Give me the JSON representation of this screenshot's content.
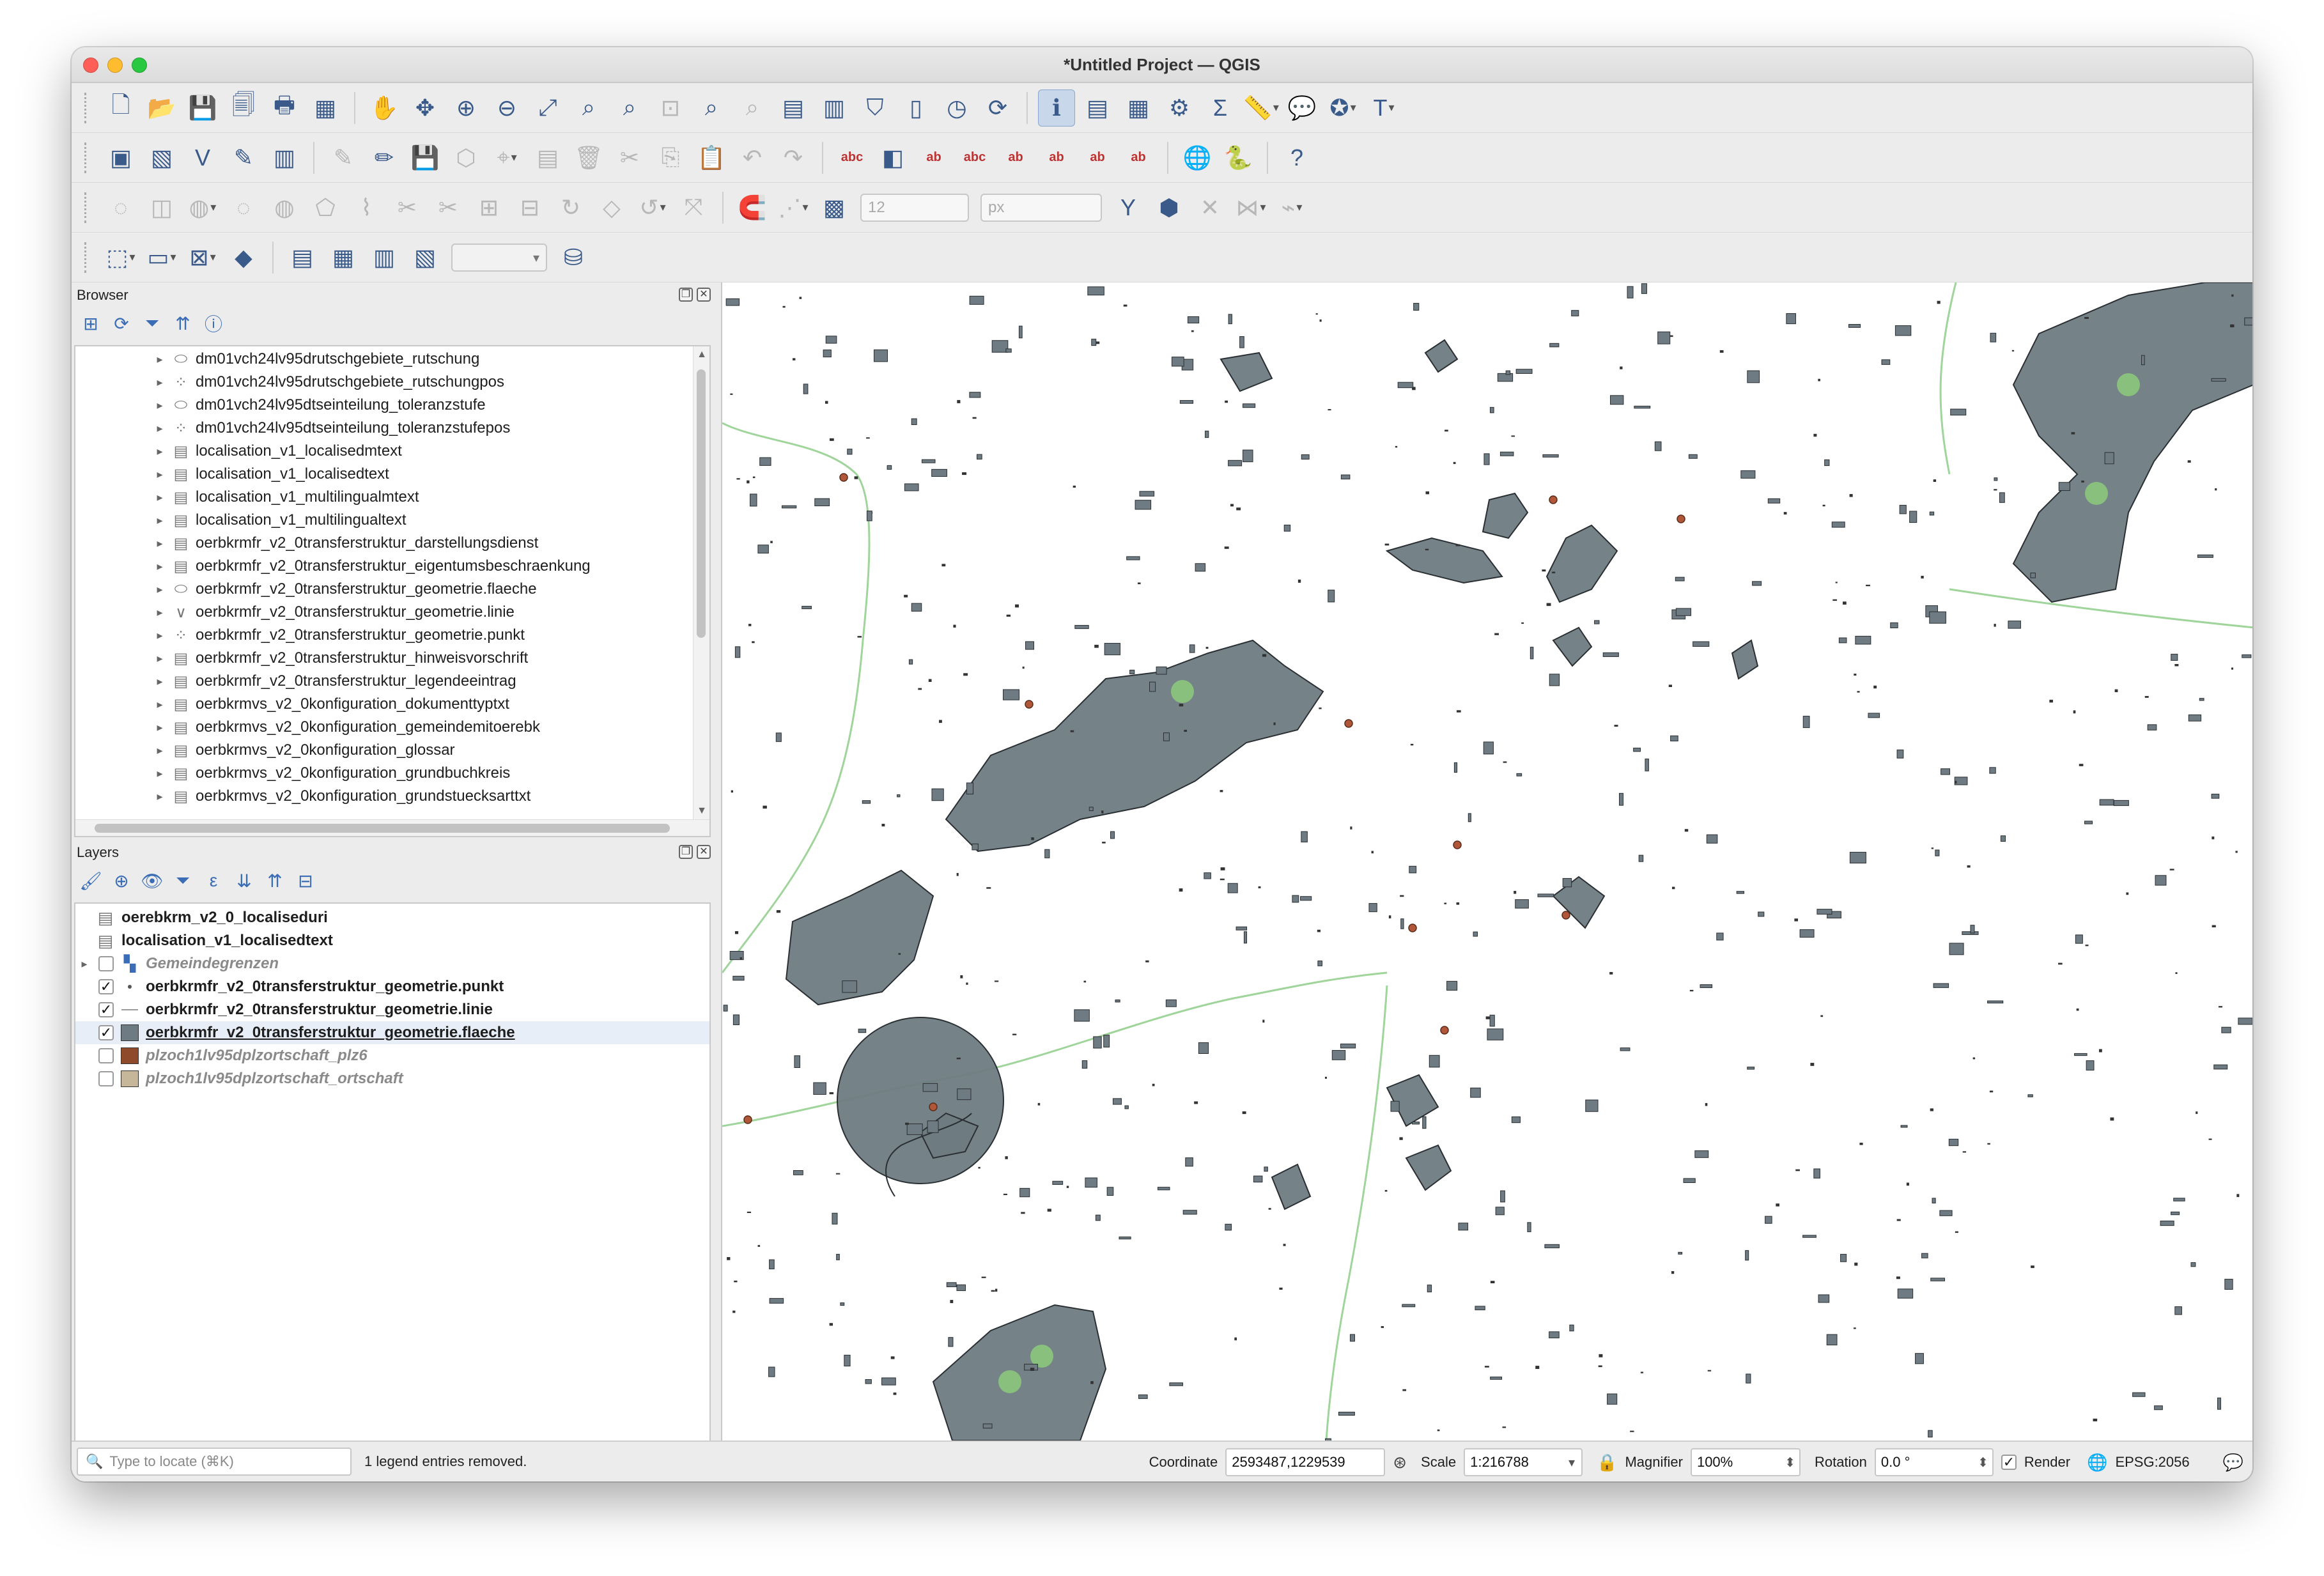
{
  "window": {
    "title": "*Untitled Project — QGIS"
  },
  "toolbars": {
    "row1": [
      "new-project-icon",
      "open-project-icon",
      "save-project-icon",
      "save-as-icon",
      "print-layout-icon",
      "layout-manager-icon",
      "|",
      "pan-icon",
      "pan-to-selection-icon",
      "zoom-in-icon",
      "zoom-out-icon",
      "zoom-full-icon",
      "zoom-to-selection-icon",
      "zoom-to-layer-icon",
      "zoom-native-icon",
      "zoom-last-icon",
      "zoom-next-icon",
      "new-bookmark-icon",
      "show-bookmarks-icon",
      "temporal-icon",
      "tile-scale-icon",
      "time-controller-icon",
      "refresh-icon",
      "|",
      "identify-icon",
      "attribute-table-icon",
      "field-calculator-icon",
      "processing-toolbox-icon",
      "statistics-icon",
      "measure-icon",
      "map-tips-icon",
      "annotation-icon",
      "text-annotation-icon"
    ],
    "row2": [
      "data-source-manager-icon",
      "new-geopackage-icon",
      "new-shapefile-icon",
      "new-temporary-layer-icon",
      "new-virtual-layer-icon",
      "|",
      "digitize-icon",
      "edit-pencil-icon",
      "save-edits-icon",
      "add-feature-icon",
      "vertex-tool-icon",
      "modify-attributes-icon",
      "delete-selected-icon",
      "cut-icon",
      "copy-icon",
      "paste-icon",
      "undo-icon",
      "redo-icon",
      "|",
      "label-tool-icon",
      "diagram-tool-icon",
      "label-pin-icon",
      "label-highlight-icon",
      "label-show-hide-icon",
      "label-move-icon",
      "label-rotate-icon",
      "label-change-icon",
      "|",
      "plugin-globe-icon",
      "python-console-icon",
      "|",
      "help-icon"
    ],
    "row3": [
      "add-ring-icon",
      "add-part-icon",
      "fill-ring-icon",
      "delete-ring-icon",
      "delete-part-icon",
      "reshape-icon",
      "offset-curve-icon",
      "split-features-icon",
      "split-parts-icon",
      "merge-features-icon",
      "merge-attributes-icon",
      "rotate-point-symbols-icon",
      "simplify-icon",
      "rotate-feature-icon",
      "scale-feature-icon",
      "|",
      "snapping-magnet-icon",
      "snapping-type-icon",
      "snapping-grid-icon"
    ],
    "row3_tolerance": "12",
    "row3_unit": "px",
    "row3_after": [
      "tracing-icon",
      "self-snapping-icon",
      "intersection-icon",
      "topology-icon",
      "avoid-overlap-icon"
    ],
    "row4": [
      "select-features-icon",
      "deselect-icon",
      "select-by-expression-icon",
      "select-location-icon",
      "|",
      "db-manager-icon",
      "open-table-icon",
      "create-view-icon",
      "query-builder-icon"
    ],
    "row4_after": [
      "db-stack-icon"
    ]
  },
  "browser": {
    "title": "Browser",
    "tools": [
      "add-selected-icon",
      "refresh-browser-icon",
      "filter-browser-icon",
      "collapse-all-icon",
      "properties-icon"
    ],
    "items": [
      {
        "icon": "polygon",
        "label": "dm01vch24lv95drutschgebiete_rutschung"
      },
      {
        "icon": "point",
        "label": "dm01vch24lv95drutschgebiete_rutschungpos"
      },
      {
        "icon": "polygon",
        "label": "dm01vch24lv95dtseinteilung_toleranzstufe"
      },
      {
        "icon": "point",
        "label": "dm01vch24lv95dtseinteilung_toleranzstufepos"
      },
      {
        "icon": "table",
        "label": "localisation_v1_localisedmtext"
      },
      {
        "icon": "table",
        "label": "localisation_v1_localisedtext"
      },
      {
        "icon": "table",
        "label": "localisation_v1_multilingualmtext"
      },
      {
        "icon": "table",
        "label": "localisation_v1_multilingualtext"
      },
      {
        "icon": "table",
        "label": "oerbkrmfr_v2_0transferstruktur_darstellungsdienst"
      },
      {
        "icon": "table",
        "label": "oerbkrmfr_v2_0transferstruktur_eigentumsbeschraenkung"
      },
      {
        "icon": "polygon",
        "label": "oerbkrmfr_v2_0transferstruktur_geometrie.flaeche"
      },
      {
        "icon": "line",
        "label": "oerbkrmfr_v2_0transferstruktur_geometrie.linie"
      },
      {
        "icon": "point",
        "label": "oerbkrmfr_v2_0transferstruktur_geometrie.punkt"
      },
      {
        "icon": "table",
        "label": "oerbkrmfr_v2_0transferstruktur_hinweisvorschrift"
      },
      {
        "icon": "table",
        "label": "oerbkrmfr_v2_0transferstruktur_legendeeintrag"
      },
      {
        "icon": "table",
        "label": "oerbkrmvs_v2_0konfiguration_dokumenttyptxt"
      },
      {
        "icon": "table",
        "label": "oerbkrmvs_v2_0konfiguration_gemeindemitoerebk"
      },
      {
        "icon": "table",
        "label": "oerbkrmvs_v2_0konfiguration_glossar"
      },
      {
        "icon": "table",
        "label": "oerbkrmvs_v2_0konfiguration_grundbuchkreis"
      },
      {
        "icon": "table",
        "label": "oerbkrmvs_v2_0konfiguration_grundstuecksarttxt"
      }
    ]
  },
  "layers": {
    "title": "Layers",
    "tools": [
      "style-panel-icon",
      "add-group-icon",
      "manage-visibility-icon",
      "filter-legend-icon",
      "filter-expression-icon",
      "expand-all-icon",
      "collapse-all-icon",
      "remove-layer-icon"
    ],
    "items": [
      {
        "label": "oerebkrm_v2_0_localiseduri",
        "symbol": "table",
        "checkbox": false,
        "checked": false,
        "expander": false,
        "enabled": true,
        "color": ""
      },
      {
        "label": "localisation_v1_localisedtext",
        "symbol": "table",
        "checkbox": false,
        "checked": false,
        "expander": false,
        "enabled": true,
        "color": ""
      },
      {
        "label": "Gemeindegrenzen",
        "symbol": "wms",
        "checkbox": true,
        "checked": false,
        "expander": true,
        "enabled": false,
        "color": ""
      },
      {
        "label": "oerbkrmfr_v2_0transferstruktur_geometrie.punkt",
        "symbol": "point",
        "checkbox": true,
        "checked": true,
        "expander": false,
        "enabled": true,
        "color": "#555555"
      },
      {
        "label": "oerbkrmfr_v2_0transferstruktur_geometrie.linie",
        "symbol": "line",
        "checkbox": true,
        "checked": true,
        "expander": false,
        "enabled": true,
        "color": "#9a9a9a"
      },
      {
        "label": "oerbkrmfr_v2_0transferstruktur_geometrie.flaeche",
        "symbol": "fill",
        "checkbox": true,
        "checked": true,
        "expander": false,
        "enabled": true,
        "color": "#6e7b82",
        "selected": true
      },
      {
        "label": "plzoch1lv95dplzortschaft_plz6",
        "symbol": "fill",
        "checkbox": true,
        "checked": false,
        "expander": false,
        "enabled": false,
        "color": "#8e4a2a"
      },
      {
        "label": "plzoch1lv95dplzortschaft_ortschaft",
        "symbol": "fill",
        "checkbox": true,
        "checked": false,
        "expander": false,
        "enabled": false,
        "color": "#c7b79a"
      }
    ]
  },
  "map": {
    "polygon_fill": "#6e7b82",
    "polygon_stroke": "#2a2f33",
    "line_color": "#9fd49a",
    "point_color": "#b0573a"
  },
  "statusbar": {
    "locator_placeholder": "Type to locate (⌘K)",
    "message": "1 legend entries removed.",
    "coordinate_label": "Coordinate",
    "coordinate_value": "2593487,1229539",
    "scale_label": "Scale",
    "scale_value": "1:216788",
    "magnifier_label": "Magnifier",
    "magnifier_value": "100%",
    "rotation_label": "Rotation",
    "rotation_value": "0.0 °",
    "render_label": "Render",
    "crs_label": "EPSG:2056"
  }
}
